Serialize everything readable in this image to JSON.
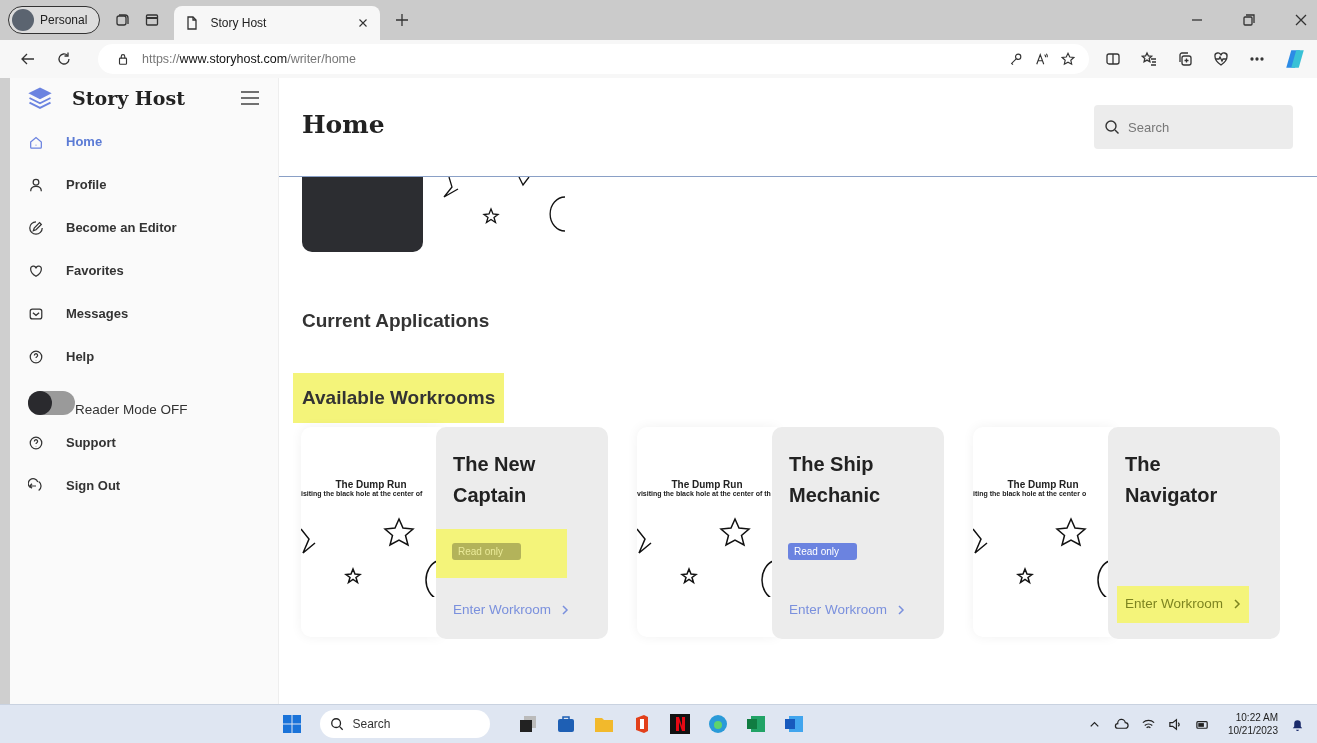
{
  "browser": {
    "profile": "Personal",
    "tabs": [
      {
        "title": "Story Host",
        "selected": true
      }
    ],
    "url_scheme": "https://",
    "url_host": "www.storyhost.com",
    "url_path": "/writer/home"
  },
  "sidebar": {
    "brand": "Story Host",
    "items": [
      {
        "kind": "link",
        "label": "Home",
        "selected": true
      },
      {
        "kind": "link",
        "label": "Profile",
        "selected": false
      },
      {
        "kind": "link",
        "label": "Become an Editor",
        "selected": false
      },
      {
        "kind": "link",
        "label": "Favorites",
        "selected": false
      },
      {
        "kind": "link",
        "label": "Messages",
        "selected": false
      },
      {
        "kind": "link",
        "label": "Help",
        "selected": false
      },
      {
        "kind": "toggle",
        "label": "Reader Mode OFF",
        "on": false
      },
      {
        "kind": "link",
        "label": "Support",
        "selected": false
      },
      {
        "kind": "link",
        "label": "Sign Out",
        "selected": false
      }
    ]
  },
  "page": {
    "title": "Home",
    "search": {
      "placeholder": "Search"
    },
    "sections": [
      {
        "title": "Current Applications",
        "highlighted": false
      },
      {
        "title": "Available Workrooms",
        "highlighted": true
      }
    ]
  },
  "workrooms": [
    {
      "cover_title": "The Dump Run",
      "cover_subtitle": "isiting the black hole at the center of",
      "title": "The New Captain",
      "badge": "Read only",
      "badge_highlighted": true,
      "link": "Enter Workroom",
      "link_highlighted": false
    },
    {
      "cover_title": "The Dump Run",
      "cover_subtitle": "visiting the black hole at the center of th",
      "title": "The Ship Mechanic",
      "badge": "Read only",
      "badge_highlighted": false,
      "link": "Enter Workroom",
      "link_highlighted": false
    },
    {
      "cover_title": "The Dump Run",
      "cover_subtitle": "iting the black hole at the center o",
      "title": "The Navigator",
      "link": "Enter Workroom",
      "link_highlighted": true
    }
  ],
  "taskbar": {
    "search": "Search",
    "time": "10:22 AM",
    "date": "10/21/2023"
  }
}
